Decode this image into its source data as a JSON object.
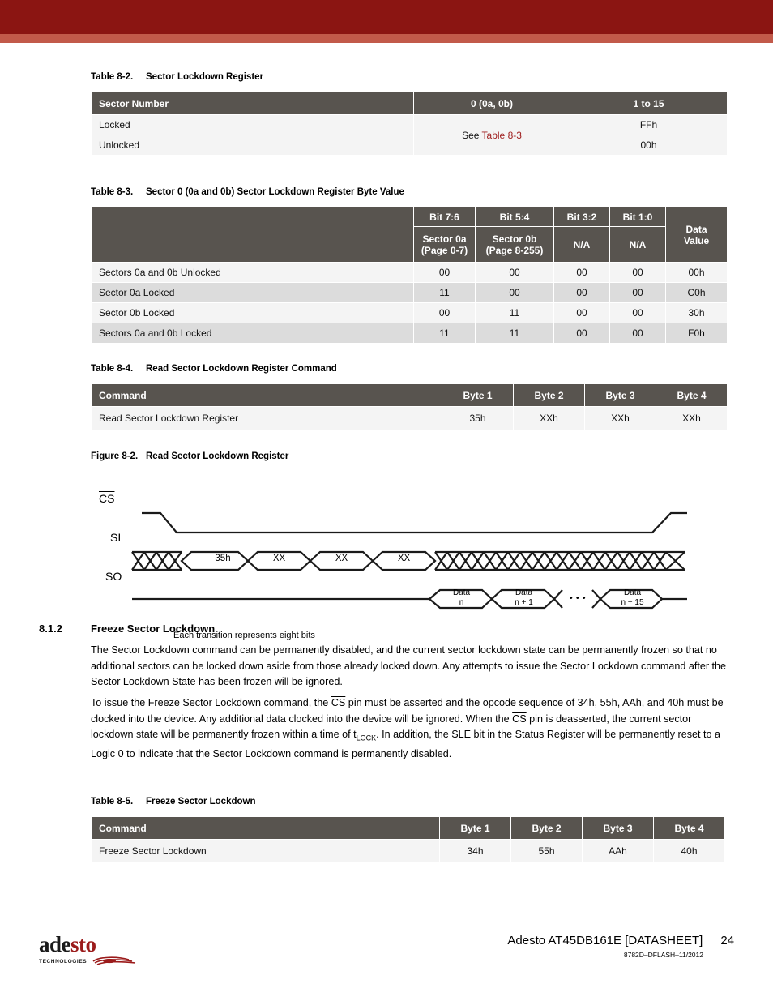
{
  "header": {
    "band_dark_color": "#8B1512",
    "band_light_color": "#C25A4A"
  },
  "table_8_2": {
    "caption_num": "Table 8-2.",
    "caption_title": "Sector Lockdown Register",
    "headers": [
      "Sector Number",
      "0 (0a, 0b)",
      "1 to 15"
    ],
    "rows": [
      {
        "label": "Locked",
        "value": "FFh"
      },
      {
        "label": "Unlocked",
        "value": "00h"
      }
    ],
    "merged_cell_prefix": "See ",
    "merged_cell_link": "Table 8-3"
  },
  "table_8_3": {
    "caption_num": "Table 8-3.",
    "caption_title": "Sector 0 (0a and 0b) Sector Lockdown Register Byte Value",
    "header_row1": [
      "",
      "Bit 7:6",
      "Bit 5:4",
      "Bit 3:2",
      "Bit 1:0",
      ""
    ],
    "header_row2_col1_line1": "Sector 0a",
    "header_row2_col1_line2": "(Page 0-7)",
    "header_row2_col2_line1": "Sector 0b",
    "header_row2_col2_line2": "(Page 8-255)",
    "header_row2_col3": "N/A",
    "header_row2_col4": "N/A",
    "header_data_line1": "Data",
    "header_data_line2": "Value",
    "rows": [
      {
        "label": "Sectors 0a and 0b Unlocked",
        "b76": "00",
        "b54": "00",
        "b32": "00",
        "b10": "00",
        "data": "00h"
      },
      {
        "label": "Sector 0a Locked",
        "b76": "11",
        "b54": "00",
        "b32": "00",
        "b10": "00",
        "data": "C0h"
      },
      {
        "label": "Sector 0b Locked",
        "b76": "00",
        "b54": "11",
        "b32": "00",
        "b10": "00",
        "data": "30h"
      },
      {
        "label": "Sectors 0a and 0b Locked",
        "b76": "11",
        "b54": "11",
        "b32": "00",
        "b10": "00",
        "data": "F0h"
      }
    ]
  },
  "table_8_4": {
    "caption_num": "Table 8-4.",
    "caption_title": "Read Sector Lockdown Register Command",
    "headers": [
      "Command",
      "Byte 1",
      "Byte 2",
      "Byte 3",
      "Byte 4"
    ],
    "row": {
      "command": "Read Sector Lockdown Register",
      "byte1": "35h",
      "byte2": "XXh",
      "byte3": "XXh",
      "byte4": "XXh"
    }
  },
  "figure_8_2": {
    "caption_num": "Figure 8-2.",
    "caption_title": "Read Sector Lockdown Register",
    "signals": {
      "cs": "CS",
      "si": "SI",
      "so": "SO"
    },
    "si_cells": [
      "35h",
      "XX",
      "XX",
      "XX"
    ],
    "so_cells": [
      {
        "line1": "Data",
        "line2": "n"
      },
      {
        "line1": "Data",
        "line2": "n + 1"
      },
      {
        "line1": "Data",
        "line2": "n + 15"
      }
    ],
    "ellipsis": "• • •",
    "legend": "Each transition represents eight bits"
  },
  "section": {
    "number": "8.1.2",
    "title": "Freeze Sector Lockdown",
    "paragraph1": "The Sector Lockdown command can be permanently disabled, and the current sector lockdown state can be permanently frozen so that no additional sectors can be locked down aside from those already locked down. Any attempts to issue the Sector Lockdown command after the Sector Lockdown State has been frozen will be ignored.",
    "paragraph2_part1": "To issue the Freeze Sector Lockdown command, the ",
    "paragraph2_cs1": "CS",
    "paragraph2_part2": " pin must be asserted and the opcode sequence of 34h, 55h, AAh, and 40h must be clocked into the device. Any additional data clocked into the device will be ignored. When the ",
    "paragraph2_cs2": "CS",
    "paragraph2_part3": " pin is deasserted, the current sector lockdown state will be permanently frozen within a time of t",
    "paragraph2_sub": "LOCK",
    "paragraph2_part4": ". In addition, the SLE bit in the Status Register will be permanently reset to a Logic 0 to indicate that the Sector Lockdown command is permanently disabled."
  },
  "table_8_5": {
    "caption_num": "Table 8-5.",
    "caption_title": "Freeze Sector Lockdown",
    "headers": [
      "Command",
      "Byte 1",
      "Byte 2",
      "Byte 3",
      "Byte 4"
    ],
    "row": {
      "command": "Freeze Sector Lockdown",
      "byte1": "34h",
      "byte2": "55h",
      "byte3": "AAh",
      "byte4": "40h"
    }
  },
  "footer": {
    "logo_part1": "ade",
    "logo_part2": "sto",
    "logo_sub": "TECHNOLOGIES",
    "title": "Adesto AT45DB161E [DATASHEET]",
    "page_number": "24",
    "doc_id": "8782D–DFLASH–11/2012"
  }
}
